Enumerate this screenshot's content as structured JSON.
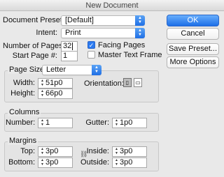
{
  "window": {
    "title": "New Document"
  },
  "top": {
    "document_preset_label": "Document Preset:",
    "document_preset_value": "[Default]",
    "intent_label": "Intent:",
    "intent_value": "Print",
    "num_pages_label": "Number of Pages:",
    "num_pages_value": "32",
    "start_page_label": "Start Page #:",
    "start_page_value": "1",
    "facing_pages_label": "Facing Pages",
    "facing_pages_checked": true,
    "master_text_frame_label": "Master Text Frame",
    "master_text_frame_checked": false
  },
  "buttons": {
    "ok": "OK",
    "cancel": "Cancel",
    "save_preset": "Save Preset...",
    "more_options": "More Options"
  },
  "page_size": {
    "label": "Page Size:",
    "value": "Letter",
    "width_label": "Width:",
    "width_value": "51p0",
    "height_label": "Height:",
    "height_value": "66p0",
    "orientation_label": "Orientation:",
    "orientation_selected": "portrait"
  },
  "columns": {
    "title": "Columns",
    "number_label": "Number:",
    "number_value": "1",
    "gutter_label": "Gutter:",
    "gutter_value": "1p0"
  },
  "margins": {
    "title": "Margins",
    "top_label": "Top:",
    "top_value": "3p0",
    "bottom_label": "Bottom:",
    "bottom_value": "3p0",
    "inside_label": "Inside:",
    "inside_value": "3p0",
    "outside_label": "Outside:",
    "outside_value": "3p0"
  },
  "icons": {
    "popup_arrows": "updown-arrows-icon",
    "spinner": "stepper-icon",
    "check": "checkmark-icon",
    "portrait": "portrait-orientation-icon",
    "landscape": "landscape-orientation-icon",
    "link": "chain-link-icon"
  },
  "colors": {
    "accent": "#2b7af0",
    "background": "#e9e9e9"
  }
}
